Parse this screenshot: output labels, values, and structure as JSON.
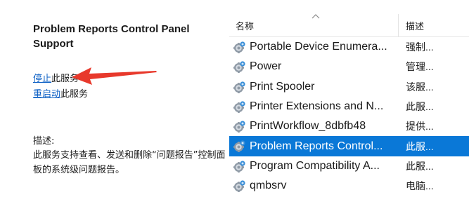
{
  "details": {
    "service_title": "Problem Reports Control Panel Support",
    "stop_link": "停止",
    "stop_suffix": "此服务",
    "restart_link": "重启动",
    "restart_suffix": "此服务",
    "description_label": "描述:",
    "description_text": "此服务支持查看、发送和删除“问题报告”控制面板的系统级问题报告。"
  },
  "list": {
    "columns": {
      "name": "名称",
      "description": "描述"
    },
    "rows": [
      {
        "name": "Portable Device Enumera...",
        "description": "强制..."
      },
      {
        "name": "Power",
        "description": "管理..."
      },
      {
        "name": "Print Spooler",
        "description": "该服..."
      },
      {
        "name": "Printer Extensions and N...",
        "description": "此服..."
      },
      {
        "name": "PrintWorkflow_8dbfb48",
        "description": "提供..."
      },
      {
        "name": "Problem Reports Control...",
        "description": "此服..."
      },
      {
        "name": "Program Compatibility A...",
        "description": "此服..."
      },
      {
        "name": "qmbsrv",
        "description": "电脑..."
      }
    ],
    "selected_index": 5
  },
  "colors": {
    "link": "#0b5fc4",
    "selection": "#0a78d7",
    "annotation_arrow": "#e8392c"
  },
  "icons": {
    "row_icon": "service-gear-icon",
    "sort_indicator": "sort-ascending-chevron-icon"
  }
}
